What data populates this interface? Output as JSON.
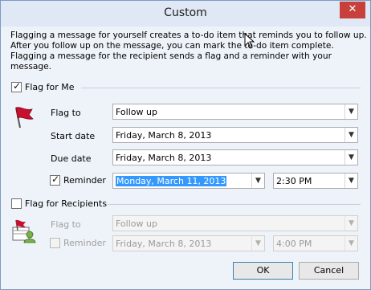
{
  "window": {
    "title": "Custom",
    "close_glyph": "✕"
  },
  "description": {
    "lines": [
      "Flagging a message for yourself creates a to-do item that reminds you to follow up.",
      "After you follow up on the message, you can mark the to-do item complete.",
      "Flagging a message for the recipient sends a flag and a reminder with your",
      "message."
    ]
  },
  "flag_for_me": {
    "label": "Flag for Me",
    "checked": true,
    "icon": "red-flag-icon",
    "flag_to_label": "Flag to",
    "flag_to_value": "Follow up",
    "start_date_label": "Start date",
    "start_date_value": "Friday, March 8, 2013",
    "due_date_label": "Due date",
    "due_date_value": "Friday, March 8, 2013",
    "reminder_label": "Reminder",
    "reminder_checked": true,
    "reminder_date_value": "Monday, March 11, 2013",
    "reminder_time_value": "2:30 PM"
  },
  "flag_for_recipients": {
    "label": "Flag for Recipients",
    "checked": false,
    "icon": "recipient-flag-icon",
    "flag_to_label": "Flag to",
    "flag_to_value": "Follow up",
    "reminder_label": "Reminder",
    "reminder_checked": false,
    "reminder_date_value": "Friday, March 8, 2013",
    "reminder_time_value": "4:00 PM"
  },
  "buttons": {
    "ok": "OK",
    "cancel": "Cancel"
  },
  "icons": {
    "dropdown": "chevron-down-icon",
    "cursor": "mouse-pointer-icon"
  },
  "colors": {
    "title_bar": "#dfe8f4",
    "close": "#c7403b",
    "selection": "#3399ff",
    "flag_red": "#c8102e"
  }
}
